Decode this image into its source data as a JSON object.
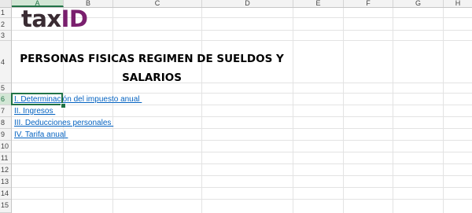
{
  "columns": [
    {
      "label": "A",
      "selected": true
    },
    {
      "label": "B",
      "selected": false
    },
    {
      "label": "C",
      "selected": false
    },
    {
      "label": "D",
      "selected": false
    },
    {
      "label": "E",
      "selected": false
    },
    {
      "label": "F",
      "selected": false
    },
    {
      "label": "G",
      "selected": false
    },
    {
      "label": "H",
      "selected": false
    }
  ],
  "rows": [
    "1",
    "2",
    "3",
    "4",
    "5",
    "6",
    "7",
    "8",
    "9",
    "10",
    "11",
    "12",
    "13",
    "14",
    "15"
  ],
  "selected_row": "6",
  "logo": {
    "part1": "tax",
    "part2": "ID"
  },
  "colors": {
    "accent_green": "#217346",
    "link_blue": "#0563c1",
    "logo_dark": "#3a2c33",
    "logo_purple": "#7a1f6e"
  },
  "title": {
    "line1": "PERSONAS FISICAS REGIMEN DE SUELDOS Y",
    "line2": "SALARIOS"
  },
  "links": [
    {
      "label": "I. Determinación del impuesto anual "
    },
    {
      "label": "II. Ingresos "
    },
    {
      "label": "III. Deducciones personales "
    },
    {
      "label": "IV. Tarifa anual "
    }
  ]
}
